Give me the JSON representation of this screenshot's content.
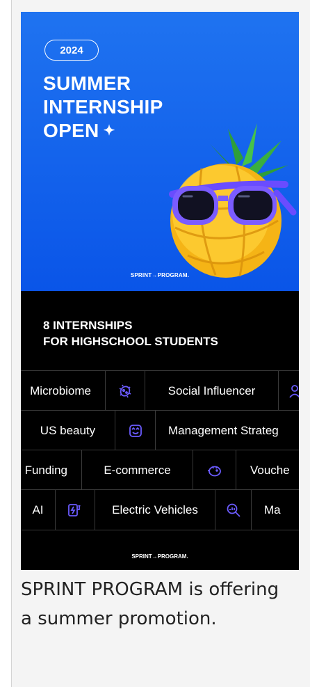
{
  "poster": {
    "year": "2024",
    "headline": [
      "SUMMER",
      "INTERNSHIP",
      "OPEN"
    ],
    "sparkle": "✦",
    "brand": "SPRINT→PROGRAM.",
    "sub_headline": [
      "8 INTERNSHIPS",
      "FOR HIGHSCHOOL STUDENTS"
    ],
    "rows": [
      [
        {
          "type": "text",
          "label": "Microbiome"
        },
        {
          "type": "icon",
          "icon": "microbe-icon"
        },
        {
          "type": "text",
          "label": "Social Influencer"
        },
        {
          "type": "icon",
          "icon": "person-icon"
        }
      ],
      [
        {
          "type": "text",
          "label": "US beauty"
        },
        {
          "type": "icon",
          "icon": "face-icon"
        },
        {
          "type": "text",
          "label": "Management Strateg"
        }
      ],
      [
        {
          "type": "text",
          "label": "Funding"
        },
        {
          "type": "text",
          "label": "E-commerce"
        },
        {
          "type": "icon",
          "icon": "piggy-bank-icon"
        },
        {
          "type": "text",
          "label": "Vouche"
        }
      ],
      [
        {
          "type": "text",
          "label": "AI"
        },
        {
          "type": "icon",
          "icon": "ev-charger-icon"
        },
        {
          "type": "text",
          "label": "Electric Vehicles"
        },
        {
          "type": "icon",
          "icon": "search-chart-icon"
        },
        {
          "type": "text",
          "label": "Ma"
        }
      ]
    ],
    "icon_color": "#6b5bff",
    "top_gradient": [
      "#1f73f0",
      "#0a55e8"
    ]
  },
  "caption": "SPRINT PROGRAM is offering a summer promotion."
}
